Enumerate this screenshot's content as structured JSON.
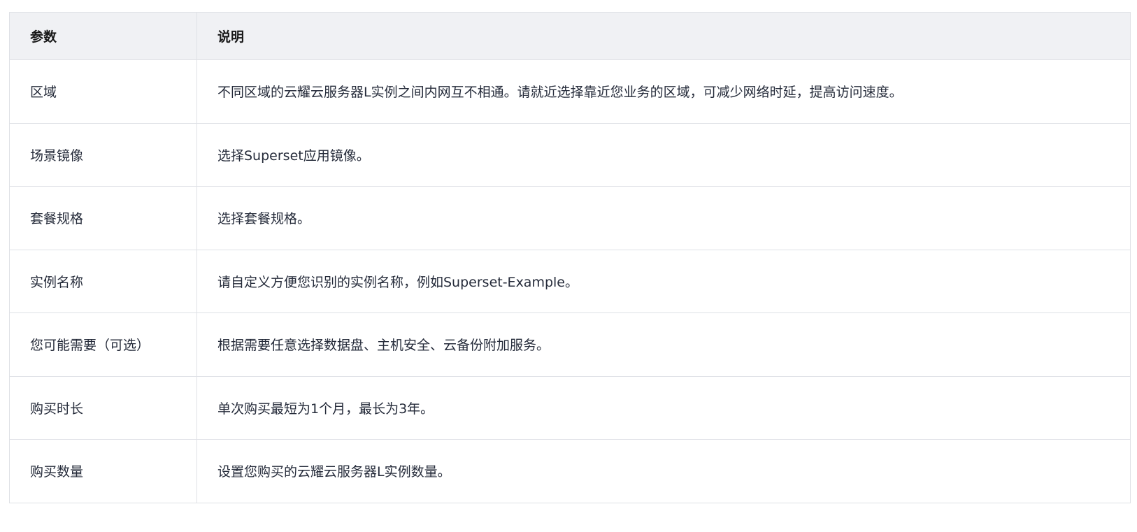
{
  "table": {
    "headers": {
      "param": "参数",
      "desc": "说明"
    },
    "rows": [
      {
        "param": "区域",
        "desc": "不同区域的云耀云服务器L实例之间内网互不相通。请就近选择靠近您业务的区域，可减少网络时延，提高访问速度。"
      },
      {
        "param": "场景镜像",
        "desc": "选择Superset应用镜像。"
      },
      {
        "param": "套餐规格",
        "desc": "选择套餐规格。"
      },
      {
        "param": "实例名称",
        "desc": "请自定义方便您识别的实例名称，例如Superset-Example。"
      },
      {
        "param": "您可能需要（可选）",
        "desc": "根据需要任意选择数据盘、主机安全、云备份附加服务。"
      },
      {
        "param": "购买时长",
        "desc": "单次购买最短为1个月，最长为3年。"
      },
      {
        "param": "购买数量",
        "desc": "设置您购买的云耀云服务器L实例数量。"
      }
    ]
  }
}
